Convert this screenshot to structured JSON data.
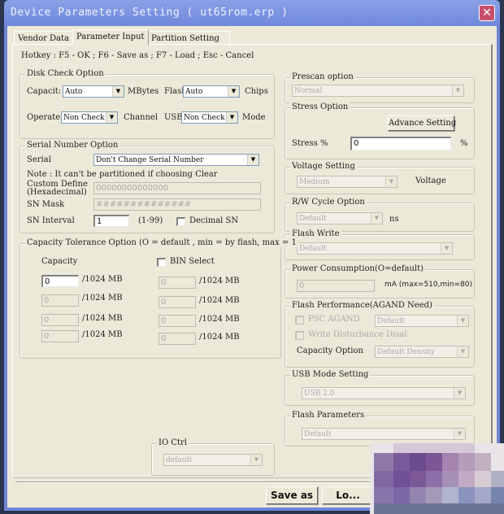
{
  "window": {
    "title": "Device Parameters Setting ( ut65rom.erp )",
    "close_label": "✕"
  },
  "tabs": [
    {
      "label": "Vendor Data",
      "active": false
    },
    {
      "label": "Parameter Input",
      "active": true
    },
    {
      "label": "Partition Setting",
      "active": false
    }
  ],
  "hotkey_text": "Hotkey : F5 - OK ; F6 - Save as ; F7 - Load ; Esc - Cancel",
  "disk_check": {
    "caption": "Disk Check Option",
    "capacity_label": "Capacit:",
    "capacity_value": "Auto",
    "capacity_unit": "MBytes",
    "flash_label": "Flasl",
    "flash_value": "Auto",
    "flash_unit": "Chips",
    "operate_label": "Operate",
    "operate_value": "Non Check",
    "channel_label": "Channel",
    "usb_label": "USB",
    "usb_value": "Non Check",
    "mode_label": "Mode"
  },
  "serial": {
    "caption": "Serial Number Option",
    "serial_label": "Serial",
    "serial_value": "Don't Change Serial Number",
    "note": "Note : It can't be partitioned if choosing Clear",
    "custom_label_1": "Custom Define",
    "custom_label_2": "(Hexadecimal)",
    "custom_value": "00000000000000",
    "mask_label": "SN Mask",
    "mask_value": "##############",
    "interval_label": "SN Interval",
    "interval_value": "1",
    "interval_range": "(1-99)",
    "decimal_label": "Decimal SN",
    "decimal_checked": false
  },
  "capacity_tolerance": {
    "caption": "Capacity Tolerance Option (O = default , min = by flash, max = 1",
    "capacity_label": "Capacity",
    "bin_select_label": "BIN Select",
    "bin_select_checked": false,
    "unit": "/1024 MB",
    "left_values": [
      "0",
      "0",
      "0",
      "0"
    ],
    "right_values": [
      "0",
      "0",
      "0",
      "0"
    ]
  },
  "io_ctrl": {
    "caption": "IO Ctrl",
    "value": "default"
  },
  "prescan": {
    "caption": "Prescan option",
    "value": "Normal"
  },
  "stress": {
    "caption": "Stress Option",
    "advance_button": "Advance Setting",
    "stress_label": "Stress %",
    "stress_value": "0",
    "unit": "%"
  },
  "voltage": {
    "caption": "Voltage Setting",
    "value": "Medium",
    "unit": "Voltage"
  },
  "rw_cycle": {
    "caption": "R/W Cycle Option",
    "value": "Default",
    "unit": "ns"
  },
  "flash_write": {
    "caption": "Flash Write",
    "value": "Default"
  },
  "power": {
    "caption": "Power Consumption(O=default)",
    "value": "0",
    "unit": "mA  (max=510,min=80)"
  },
  "flash_perf": {
    "caption": "Flash Performance(AGAND Need)",
    "psc_label": "PSC AGAND",
    "psc_value": "Default",
    "write_dist_label": "Write Disturbance Disal",
    "capacity_option_label": "Capacity Option",
    "capacity_option_value": "Default Density"
  },
  "usb_mode": {
    "caption": "USB Mode Setting",
    "value": "USB 2.0"
  },
  "flash_params": {
    "caption": "Flash Parameters",
    "value": "Default"
  },
  "buttons": {
    "save_as": "Save as",
    "load": "Lo..."
  },
  "icons": {
    "dropdown_arrow": "▼",
    "close": "✕"
  }
}
